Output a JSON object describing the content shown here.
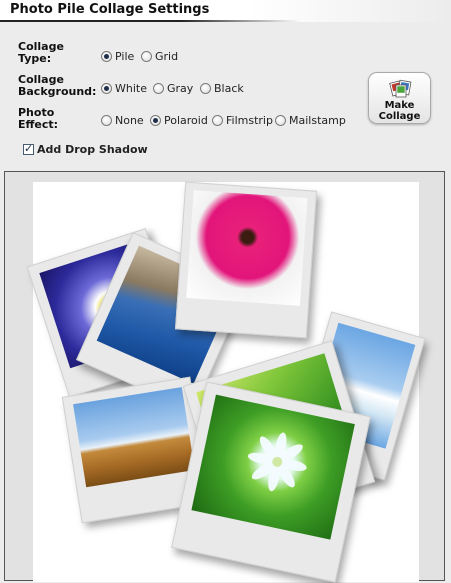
{
  "header": {
    "title": "Photo Pile Collage Settings"
  },
  "settings": {
    "collage_type": {
      "label_line1": "Collage",
      "label_line2": "Type:",
      "options": [
        "Pile",
        "Grid"
      ],
      "selected": "Pile"
    },
    "collage_background": {
      "label_line1": "Collage",
      "label_line2": "Background:",
      "options": [
        "White",
        "Gray",
        "Black"
      ],
      "selected": "White"
    },
    "photo_effect": {
      "label_line1": "Photo",
      "label_line2": "Effect:",
      "options": [
        "None",
        "Polaroid",
        "Filmstrip",
        "Mailstamp"
      ],
      "selected": "Polaroid"
    },
    "drop_shadow": {
      "label": "Add Drop Shadow",
      "checked": true
    }
  },
  "make_collage": {
    "line1": "Make",
    "line2": "Collage",
    "icon": "photos-icon"
  },
  "preview": {
    "photos": [
      "purple-flower",
      "coastal-cliffs",
      "pink-gerbera",
      "field-landscape",
      "green-leaf",
      "sky-leaves",
      "white-flower"
    ]
  }
}
